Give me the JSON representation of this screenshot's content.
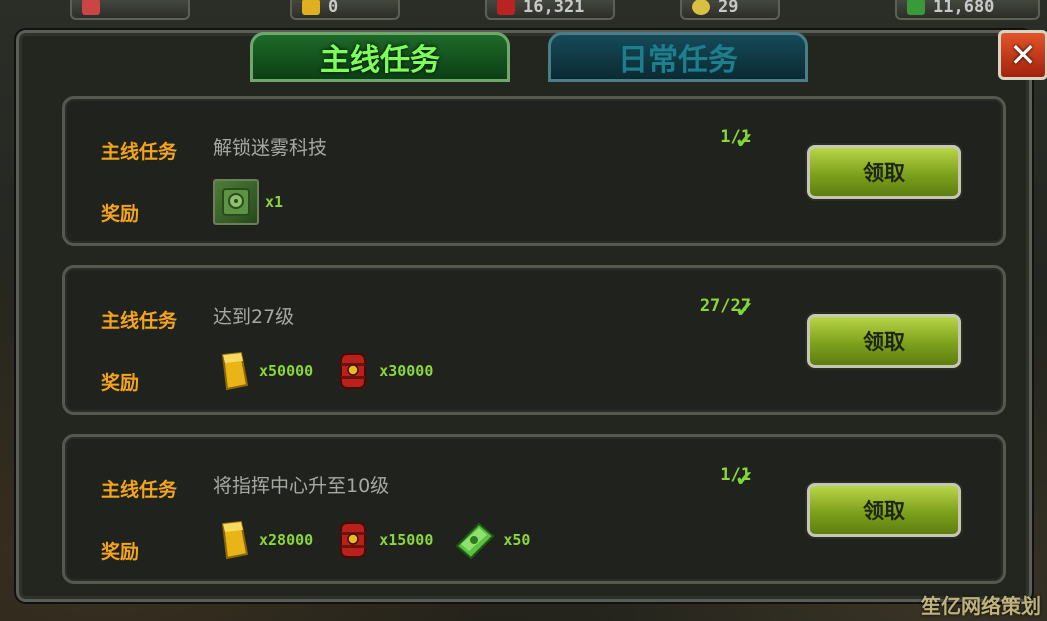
{
  "topbar": {
    "res1": "0",
    "res2": "16,321",
    "res3": "29",
    "res4": "11,680"
  },
  "tabs": {
    "main": "主线任务",
    "daily": "日常任务"
  },
  "close_label": "✕",
  "quests": [
    {
      "type_label": "主线任务",
      "desc": "解锁迷雾科技",
      "progress": "1/1",
      "reward_label": "奖励",
      "rewards": [
        {
          "icon": "tech-book-icon",
          "amount": "x1"
        }
      ],
      "claim_label": "领取"
    },
    {
      "type_label": "主线任务",
      "desc": "达到27级",
      "progress": "27/27",
      "reward_label": "奖励",
      "rewards": [
        {
          "icon": "gold-bar-icon",
          "amount": "x50000"
        },
        {
          "icon": "oil-barrel-icon",
          "amount": "x30000"
        }
      ],
      "claim_label": "领取"
    },
    {
      "type_label": "主线任务",
      "desc": "将指挥中心升至10级",
      "progress": "1/1",
      "reward_label": "奖励",
      "rewards": [
        {
          "icon": "gold-bar-icon",
          "amount": "x28000"
        },
        {
          "icon": "oil-barrel-icon",
          "amount": "x15000"
        },
        {
          "icon": "cash-stack-icon",
          "amount": "x50"
        }
      ],
      "claim_label": "领取"
    }
  ],
  "watermark": "笙亿网络策划",
  "colors": {
    "label_orange": "#f4a41c",
    "progress_green": "#8ad63c",
    "tab_active_text": "#7dff5a",
    "claim_button": "#7ea11c"
  }
}
